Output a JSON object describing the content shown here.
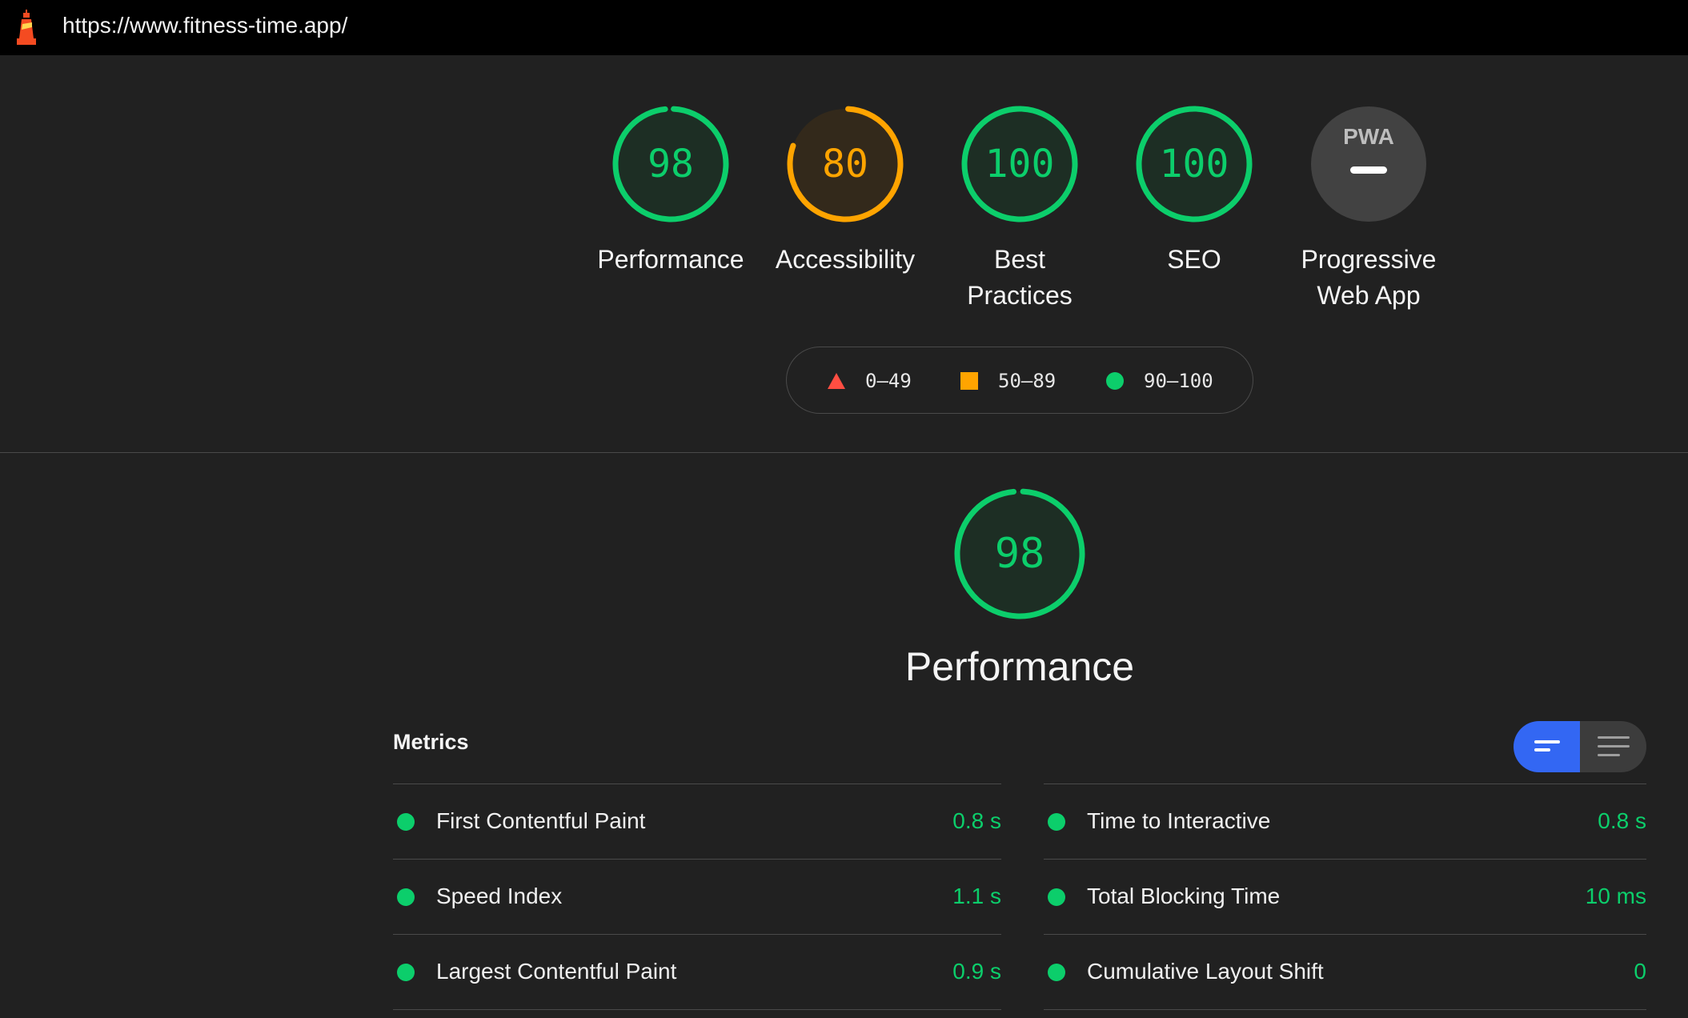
{
  "header": {
    "url": "https://www.fitness-time.app/"
  },
  "gauges": [
    {
      "label": "Performance",
      "score": "98",
      "value": 98,
      "rating": "pass",
      "color": "#0cce6b"
    },
    {
      "label": "Accessibility",
      "score": "80",
      "value": 80,
      "rating": "average",
      "color": "#ffa400"
    },
    {
      "label": "Best Practices",
      "score": "100",
      "value": 100,
      "rating": "pass",
      "color": "#0cce6b"
    },
    {
      "label": "SEO",
      "score": "100",
      "value": 100,
      "rating": "pass",
      "color": "#0cce6b"
    },
    {
      "label": "Progressive Web App",
      "pwa_badge": "PWA",
      "rating": "na"
    }
  ],
  "legend": {
    "fail": "0–49",
    "average": "50–89",
    "pass": "90–100",
    "colors": {
      "fail": "#ff4e42",
      "average": "#ffa400",
      "pass": "#0cce6b"
    }
  },
  "section": {
    "title": "Performance",
    "score": "98",
    "value": 98
  },
  "metrics": {
    "header": "Metrics",
    "left": [
      {
        "name": "First Contentful Paint",
        "value": "0.8 s"
      },
      {
        "name": "Speed Index",
        "value": "1.1 s"
      },
      {
        "name": "Largest Contentful Paint",
        "value": "0.9 s"
      }
    ],
    "right": [
      {
        "name": "Time to Interactive",
        "value": "0.8 s"
      },
      {
        "name": "Total Blocking Time",
        "value": "10 ms"
      },
      {
        "name": "Cumulative Layout Shift",
        "value": "0"
      }
    ]
  }
}
